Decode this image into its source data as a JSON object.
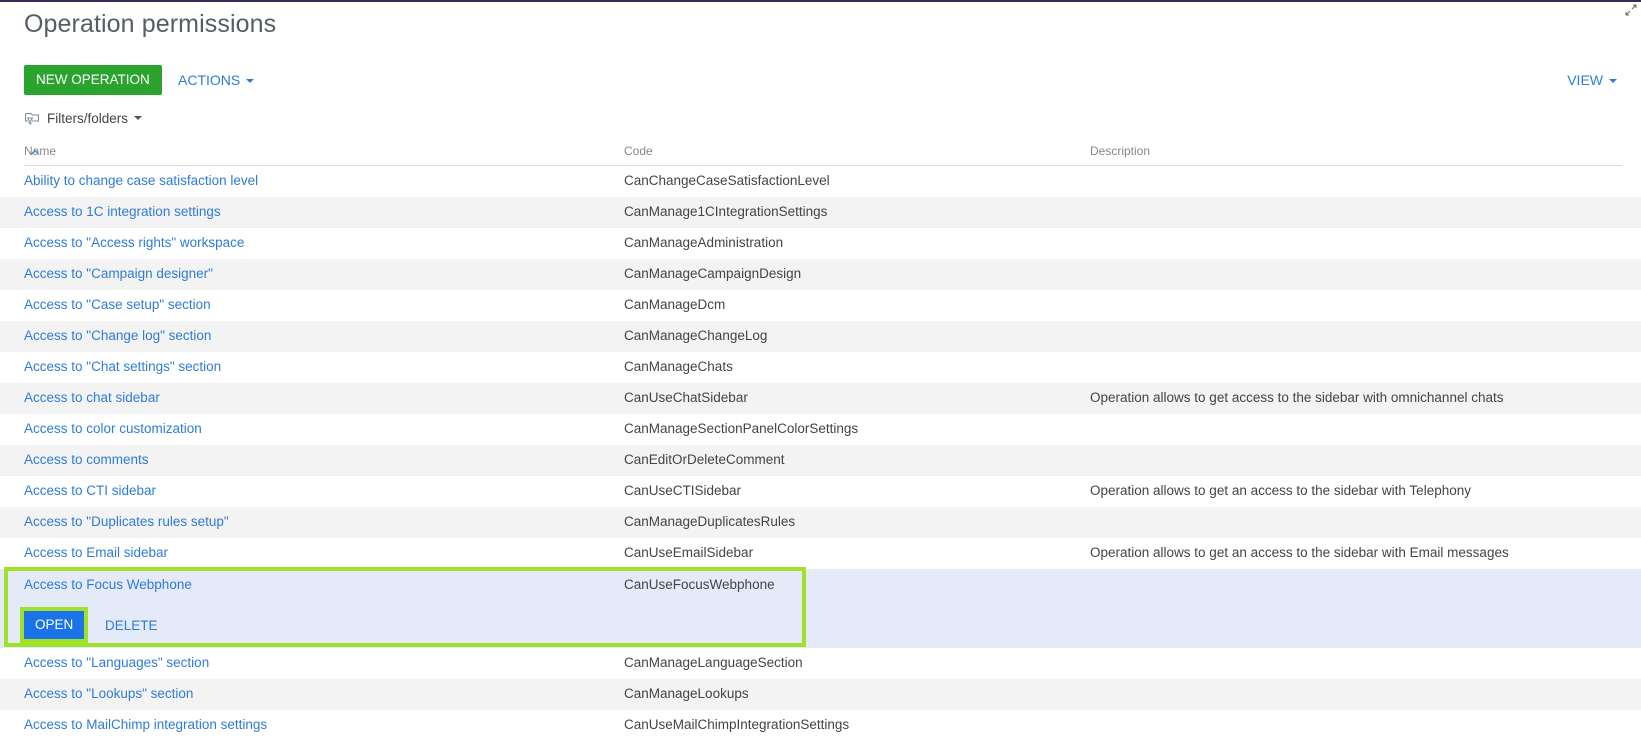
{
  "page": {
    "title": "Operation permissions"
  },
  "toolbar": {
    "new_label": "NEW OPERATION",
    "actions_label": "ACTIONS",
    "view_label": "VIEW"
  },
  "filters": {
    "label": "Filters/folders"
  },
  "columns": {
    "name": "Name",
    "code": "Code",
    "description": "Description"
  },
  "rows": [
    {
      "name": "Ability to change case satisfaction level",
      "code": "CanChangeCaseSatisfactionLevel",
      "description": ""
    },
    {
      "name": "Access to 1C integration settings",
      "code": "CanManage1CIntegrationSettings",
      "description": ""
    },
    {
      "name": "Access to \"Access rights\" workspace",
      "code": "CanManageAdministration",
      "description": ""
    },
    {
      "name": "Access to \"Campaign designer\"",
      "code": "CanManageCampaignDesign",
      "description": ""
    },
    {
      "name": "Access to \"Case setup\" section",
      "code": "CanManageDcm",
      "description": ""
    },
    {
      "name": "Access to \"Change log\" section",
      "code": "CanManageChangeLog",
      "description": ""
    },
    {
      "name": "Access to \"Chat settings\" section",
      "code": "CanManageChats",
      "description": ""
    },
    {
      "name": "Access to chat sidebar",
      "code": "CanUseChatSidebar",
      "description": "Operation allows to get access to the sidebar with omnichannel chats"
    },
    {
      "name": "Access to color customization",
      "code": "CanManageSectionPanelColorSettings",
      "description": ""
    },
    {
      "name": "Access to comments",
      "code": "CanEditOrDeleteComment",
      "description": ""
    },
    {
      "name": "Access to CTI sidebar",
      "code": "CanUseCTISidebar",
      "description": "Operation allows to get an access to the sidebar with Telephony"
    },
    {
      "name": "Access to \"Duplicates rules setup\"",
      "code": "CanManageDuplicatesRules",
      "description": ""
    },
    {
      "name": "Access to Email sidebar",
      "code": "CanUseEmailSidebar",
      "description": "Operation allows to get an access to the sidebar with Email messages"
    },
    {
      "name": "Access to Focus Webphone",
      "code": "CanUseFocusWebphone",
      "description": "",
      "selected": true
    },
    {
      "name": "Access to \"Languages\" section",
      "code": "CanManageLanguageSection",
      "description": ""
    },
    {
      "name": "Access to \"Lookups\" section",
      "code": "CanManageLookups",
      "description": ""
    },
    {
      "name": "Access to MailChimp integration settings",
      "code": "CanUseMailChimpIntegrationSettings",
      "description": ""
    }
  ],
  "row_actions": {
    "open_label": "OPEN",
    "delete_label": "DELETE"
  },
  "colors": {
    "accent": "#2e7bd8",
    "new_button": "#2aa42e",
    "highlight": "#a0e22a",
    "selected_row": "#e4eaf8"
  },
  "icons": {
    "expand": "expand-icon",
    "filter": "filter-folder-icon",
    "sort": "sort-asc-icon"
  }
}
